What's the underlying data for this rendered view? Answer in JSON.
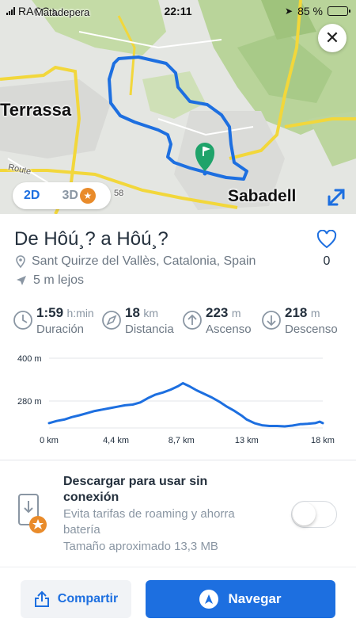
{
  "status_bar": {
    "carrier": "RACC",
    "time": "22:11",
    "battery_pct": "85 %",
    "battery_level": 0.85
  },
  "map": {
    "labels": {
      "matadepera": "Matadepera",
      "terrassa": "Terrassa",
      "sabadell": "Sabadell",
      "route": "Route",
      "num58": "58"
    },
    "toggle_2d": "2D",
    "toggle_3d": "3D",
    "route_color": "#1d6fe0",
    "start_marker_color": "#1fa36a"
  },
  "route": {
    "title": "De Hôú¸? a Hôú¸?",
    "location": "Sant Quirze del Vallès, Catalonia, Spain",
    "distance_away": "5 m lejos",
    "likes": "0"
  },
  "stats": [
    {
      "value": "1:59",
      "unit": "h:min",
      "label": "Duración",
      "icon": "clock-icon"
    },
    {
      "value": "18",
      "unit": "km",
      "label": "Distancia",
      "icon": "compass-icon"
    },
    {
      "value": "223",
      "unit": "m",
      "label": "Ascenso",
      "icon": "arrow-up-icon"
    },
    {
      "value": "218",
      "unit": "m",
      "label": "Descenso",
      "icon": "arrow-down-icon"
    }
  ],
  "chart_data": {
    "type": "line",
    "title": "",
    "xlabel": "",
    "ylabel": "",
    "y_tick_labels": [
      "400 m",
      "280 m"
    ],
    "y_ticks": [
      400,
      280
    ],
    "x_tick_labels": [
      "0 km",
      "4,4 km",
      "8,7 km",
      "13 km",
      "18 km"
    ],
    "x_ticks": [
      0,
      4.4,
      8.7,
      13,
      18
    ],
    "xlim": [
      0,
      18
    ],
    "ylim": [
      200,
      400
    ],
    "grid": true,
    "series": [
      {
        "x": [
          0,
          0.5,
          1,
          1.5,
          2,
          2.5,
          3,
          3.5,
          4,
          4.5,
          5,
          5.5,
          6,
          6.5,
          7,
          7.5,
          8,
          8.5,
          8.8,
          9.2,
          9.7,
          10.2,
          10.7,
          11.2,
          11.7,
          12.2,
          12.7,
          13,
          13.5,
          14,
          14.5,
          15,
          15.5,
          16,
          16.5,
          17,
          17.5,
          17.8,
          18
        ],
        "values": [
          218,
          224,
          228,
          235,
          240,
          246,
          252,
          256,
          260,
          264,
          268,
          270,
          276,
          288,
          298,
          304,
          312,
          322,
          330,
          322,
          310,
          300,
          290,
          278,
          264,
          252,
          238,
          228,
          218,
          212,
          210,
          210,
          209,
          211,
          215,
          216,
          218,
          222,
          218
        ]
      }
    ]
  },
  "offline": {
    "title": "Descargar para usar sin conexión",
    "description": "Evita tarifas de roaming y ahorra batería",
    "size": "Tamaño aproximado 13,3 MB",
    "enabled": false
  },
  "actions": {
    "share_label": "Compartir",
    "navigate_label": "Navegar"
  }
}
